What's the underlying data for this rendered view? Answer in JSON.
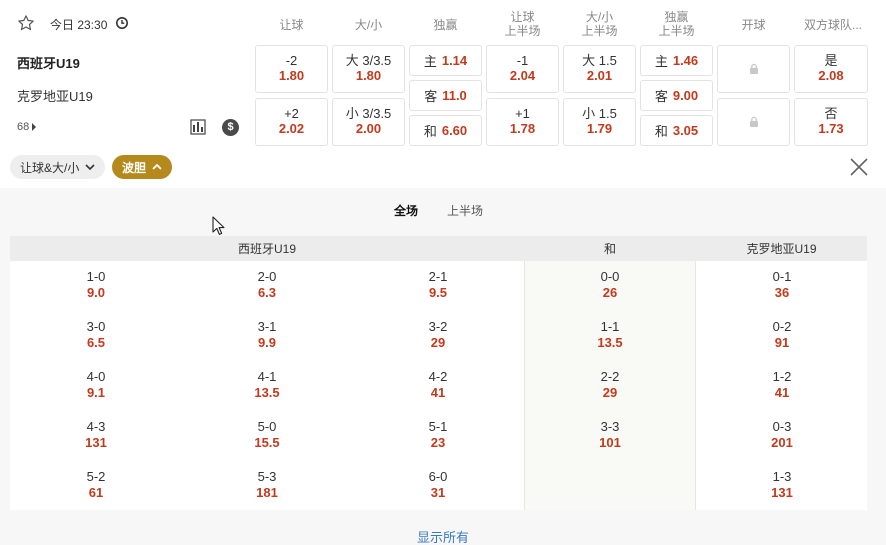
{
  "match": {
    "time": "今日 23:30",
    "team_home": "西班牙U19",
    "team_away": "克罗地亚U19",
    "more_count": "68"
  },
  "columns": [
    {
      "line1": "让球",
      "line2": ""
    },
    {
      "line1": "大/小",
      "line2": ""
    },
    {
      "line1": "独赢",
      "line2": ""
    },
    {
      "line1": "让球",
      "line2": "上半场"
    },
    {
      "line1": "大/小",
      "line2": "上半场"
    },
    {
      "line1": "独赢",
      "line2": "上半场"
    },
    {
      "line1": "开球",
      "line2": ""
    },
    {
      "line1": "双方球队...",
      "line2": ""
    }
  ],
  "odds": {
    "handicap": [
      {
        "label": "-2",
        "odd": "1.80"
      },
      {
        "label": "+2",
        "odd": "2.02"
      }
    ],
    "over_under": [
      {
        "label": "大 3/3.5",
        "odd": "1.80"
      },
      {
        "label": "小 3/3.5",
        "odd": "2.00"
      }
    ],
    "win": [
      {
        "label": "主",
        "odd": "1.14"
      },
      {
        "label": "客",
        "odd": "11.0"
      },
      {
        "label": "和",
        "odd": "6.60"
      }
    ],
    "handicap_half": [
      {
        "label": "-1",
        "odd": "2.04"
      },
      {
        "label": "+1",
        "odd": "1.78"
      }
    ],
    "over_under_half": [
      {
        "label": "大 1.5",
        "odd": "2.01"
      },
      {
        "label": "小 1.5",
        "odd": "1.79"
      }
    ],
    "win_half": [
      {
        "label": "主",
        "odd": "1.46"
      },
      {
        "label": "客",
        "odd": "9.00"
      },
      {
        "label": "和",
        "odd": "3.05"
      }
    ],
    "both_score": [
      {
        "label": "是",
        "odd": "2.08"
      },
      {
        "label": "否",
        "odd": "1.73"
      }
    ]
  },
  "filters": {
    "pill1": "让球&大/小",
    "pill2": "波胆"
  },
  "panel": {
    "tabs": [
      "全场",
      "上半场"
    ],
    "head_home": "西班牙U19",
    "head_draw": "和",
    "head_away": "克罗地亚U19",
    "home_col1": [
      {
        "s": "1-0",
        "o": "9.0"
      },
      {
        "s": "3-0",
        "o": "6.5"
      },
      {
        "s": "4-0",
        "o": "9.1"
      },
      {
        "s": "4-3",
        "o": "131"
      },
      {
        "s": "5-2",
        "o": "61"
      }
    ],
    "home_col2": [
      {
        "s": "2-0",
        "o": "6.3"
      },
      {
        "s": "3-1",
        "o": "9.9"
      },
      {
        "s": "4-1",
        "o": "13.5"
      },
      {
        "s": "5-0",
        "o": "15.5"
      },
      {
        "s": "5-3",
        "o": "181"
      }
    ],
    "home_col3": [
      {
        "s": "2-1",
        "o": "9.5"
      },
      {
        "s": "3-2",
        "o": "29"
      },
      {
        "s": "4-2",
        "o": "41"
      },
      {
        "s": "5-1",
        "o": "23"
      },
      {
        "s": "6-0",
        "o": "31"
      }
    ],
    "draw_col": [
      {
        "s": "0-0",
        "o": "26"
      },
      {
        "s": "1-1",
        "o": "13.5"
      },
      {
        "s": "2-2",
        "o": "29"
      },
      {
        "s": "3-3",
        "o": "101"
      }
    ],
    "away_col": [
      {
        "s": "0-1",
        "o": "36"
      },
      {
        "s": "0-2",
        "o": "91"
      },
      {
        "s": "1-2",
        "o": "41"
      },
      {
        "s": "0-3",
        "o": "201"
      },
      {
        "s": "1-3",
        "o": "131"
      }
    ],
    "show_all": "显示所有"
  }
}
